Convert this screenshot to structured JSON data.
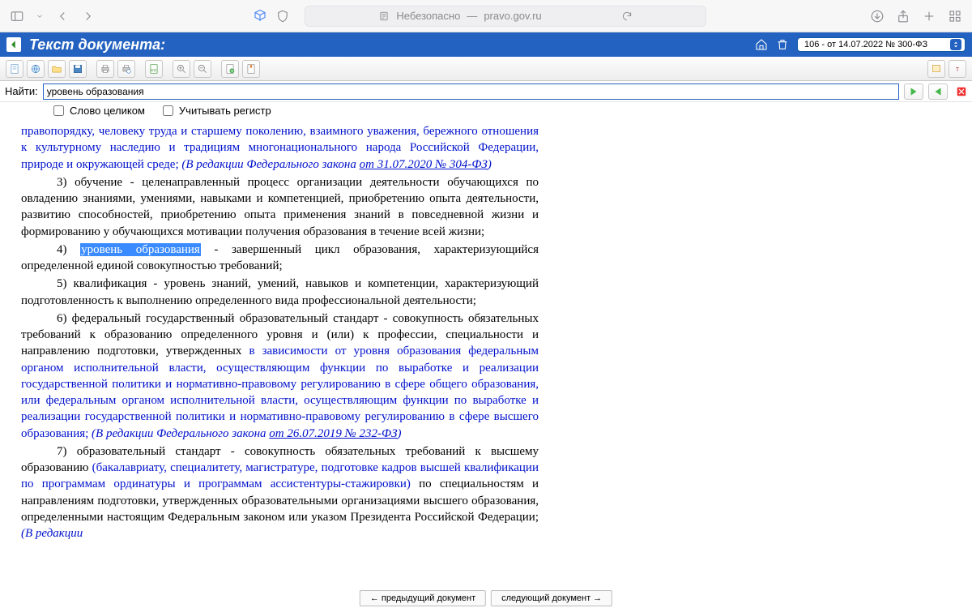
{
  "browser": {
    "label_insecure": "Небезопасно",
    "host": "pravo.gov.ru"
  },
  "header": {
    "title": "Текст документа:",
    "dropdown": "106 - от 14.07.2022 № 300-ФЗ"
  },
  "find": {
    "label": "Найти:",
    "value": "уровень образования",
    "whole_word": "Слово целиком",
    "match_case": "Учитывать регистр"
  },
  "doc": {
    "p1_a": "правопорядку, человеку труда и старшему поколению, взаимного уважения, бережного отношения к культурному наследию и традициям многонационального народа Российской Федерации, природе и окружающей среде; ",
    "p1_b_italic": "(В редакции Федерального закона ",
    "p1_link": "от 31.07.2020 № 304-ФЗ",
    "p1_c_italic": ")",
    "p3": "3) обучение - целенаправленный процесс организации деятельности обучающихся по овладению знаниями, умениями, навыками и компетенцией, приобретению опыта деятельности, развитию способностей, приобретению опыта применения знаний в повседневной жизни и формированию у обучающихся мотивации получения образования в течение всей жизни;",
    "p4_a": "4) ",
    "p4_hl": "уровень образования",
    "p4_b": " - завершенный цикл образования, характеризующийся определенной единой совокупностью требований;",
    "p5": "5) квалификация - уровень знаний, умений, навыков и компетенции, характеризующий подготовленность к выполнению определенного вида профессиональной деятельности;",
    "p6_a": "6) федеральный государственный образовательный стандарт - совокупность обязательных требований к образованию определенного уровня и (или) к профессии, специальности и направлению подготовки, утвержденных ",
    "p6_b_blue": "в зависимости от уровня образования федеральным органом исполнительной власти, осуществляющим функции по выработке и реализации государственной политики и нормативно-правовому регулированию в сфере общего образования, или федеральным органом исполнительной власти, осуществляющим функции по выработке и реализации государственной политики и нормативно-правовому регулированию в сфере высшего образования; ",
    "p6_c_italic": "(В редакции Федерального закона ",
    "p6_link": "от 26.07.2019 № 232-ФЗ",
    "p6_d_italic": ")",
    "p7_a": "7) образовательный стандарт - совокупность обязательных требований к высшему образованию ",
    "p7_b_blue": "(бакалавриату, специалитету, магистратуре, подготовке кадров высшей квалификации по программам ординатуры и программам ассистентуры-стажировки)",
    "p7_c": " по специальностям и направлениям подготовки, утвержденных образовательными организациями высшего образования, определенными настоящим Федеральным законом или указом Президента Российской Федерации; ",
    "p7_d_italic": "(В редакции"
  },
  "nav": {
    "prev": "← предыдущий документ",
    "next": "следующий документ →"
  }
}
